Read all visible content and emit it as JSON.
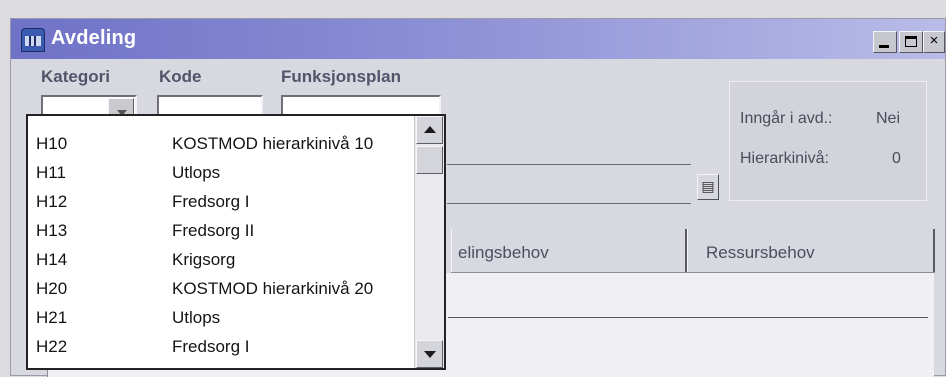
{
  "window": {
    "title": "Avdeling",
    "icon": "building-icon",
    "controls": {
      "minimize": "minimize-icon",
      "maximize": "maximize-icon",
      "close": "×"
    }
  },
  "form": {
    "kategori_label": "Kategori",
    "kode_label": "Kode",
    "funksjonsplan_label": "Funksjonsplan",
    "kategori_value": "",
    "kode_value": "",
    "funksjonsplan_value": ""
  },
  "info": {
    "inngar_label": "Inngår i avd.:",
    "inngar_value": "Nei",
    "hierarki_label": "Hierarkinivå:",
    "hierarki_value": "0"
  },
  "lookup_button": {
    "glyph": "▤",
    "icon": "list-icon"
  },
  "tabs": [
    {
      "label": "elingsbehov"
    },
    {
      "label": "Ressursbehov"
    }
  ],
  "dropdown": {
    "items": [
      {
        "code": "H10",
        "desc": "KOSTMOD hierarkinivå 10"
      },
      {
        "code": "H11",
        "desc": "Utlops"
      },
      {
        "code": "H12",
        "desc": "Fredsorg I"
      },
      {
        "code": "H13",
        "desc": "Fredsorg II"
      },
      {
        "code": "H14",
        "desc": "Krigsorg"
      },
      {
        "code": "H20",
        "desc": "KOSTMOD hierarkinivå 20"
      },
      {
        "code": "H21",
        "desc": "Utlops"
      },
      {
        "code": "H22",
        "desc": "Fredsorg I"
      }
    ]
  },
  "colors": {
    "titlebar_start": "#6f72c7",
    "titlebar_end": "#b9bce8",
    "window_bg": "#d8d8e0"
  }
}
